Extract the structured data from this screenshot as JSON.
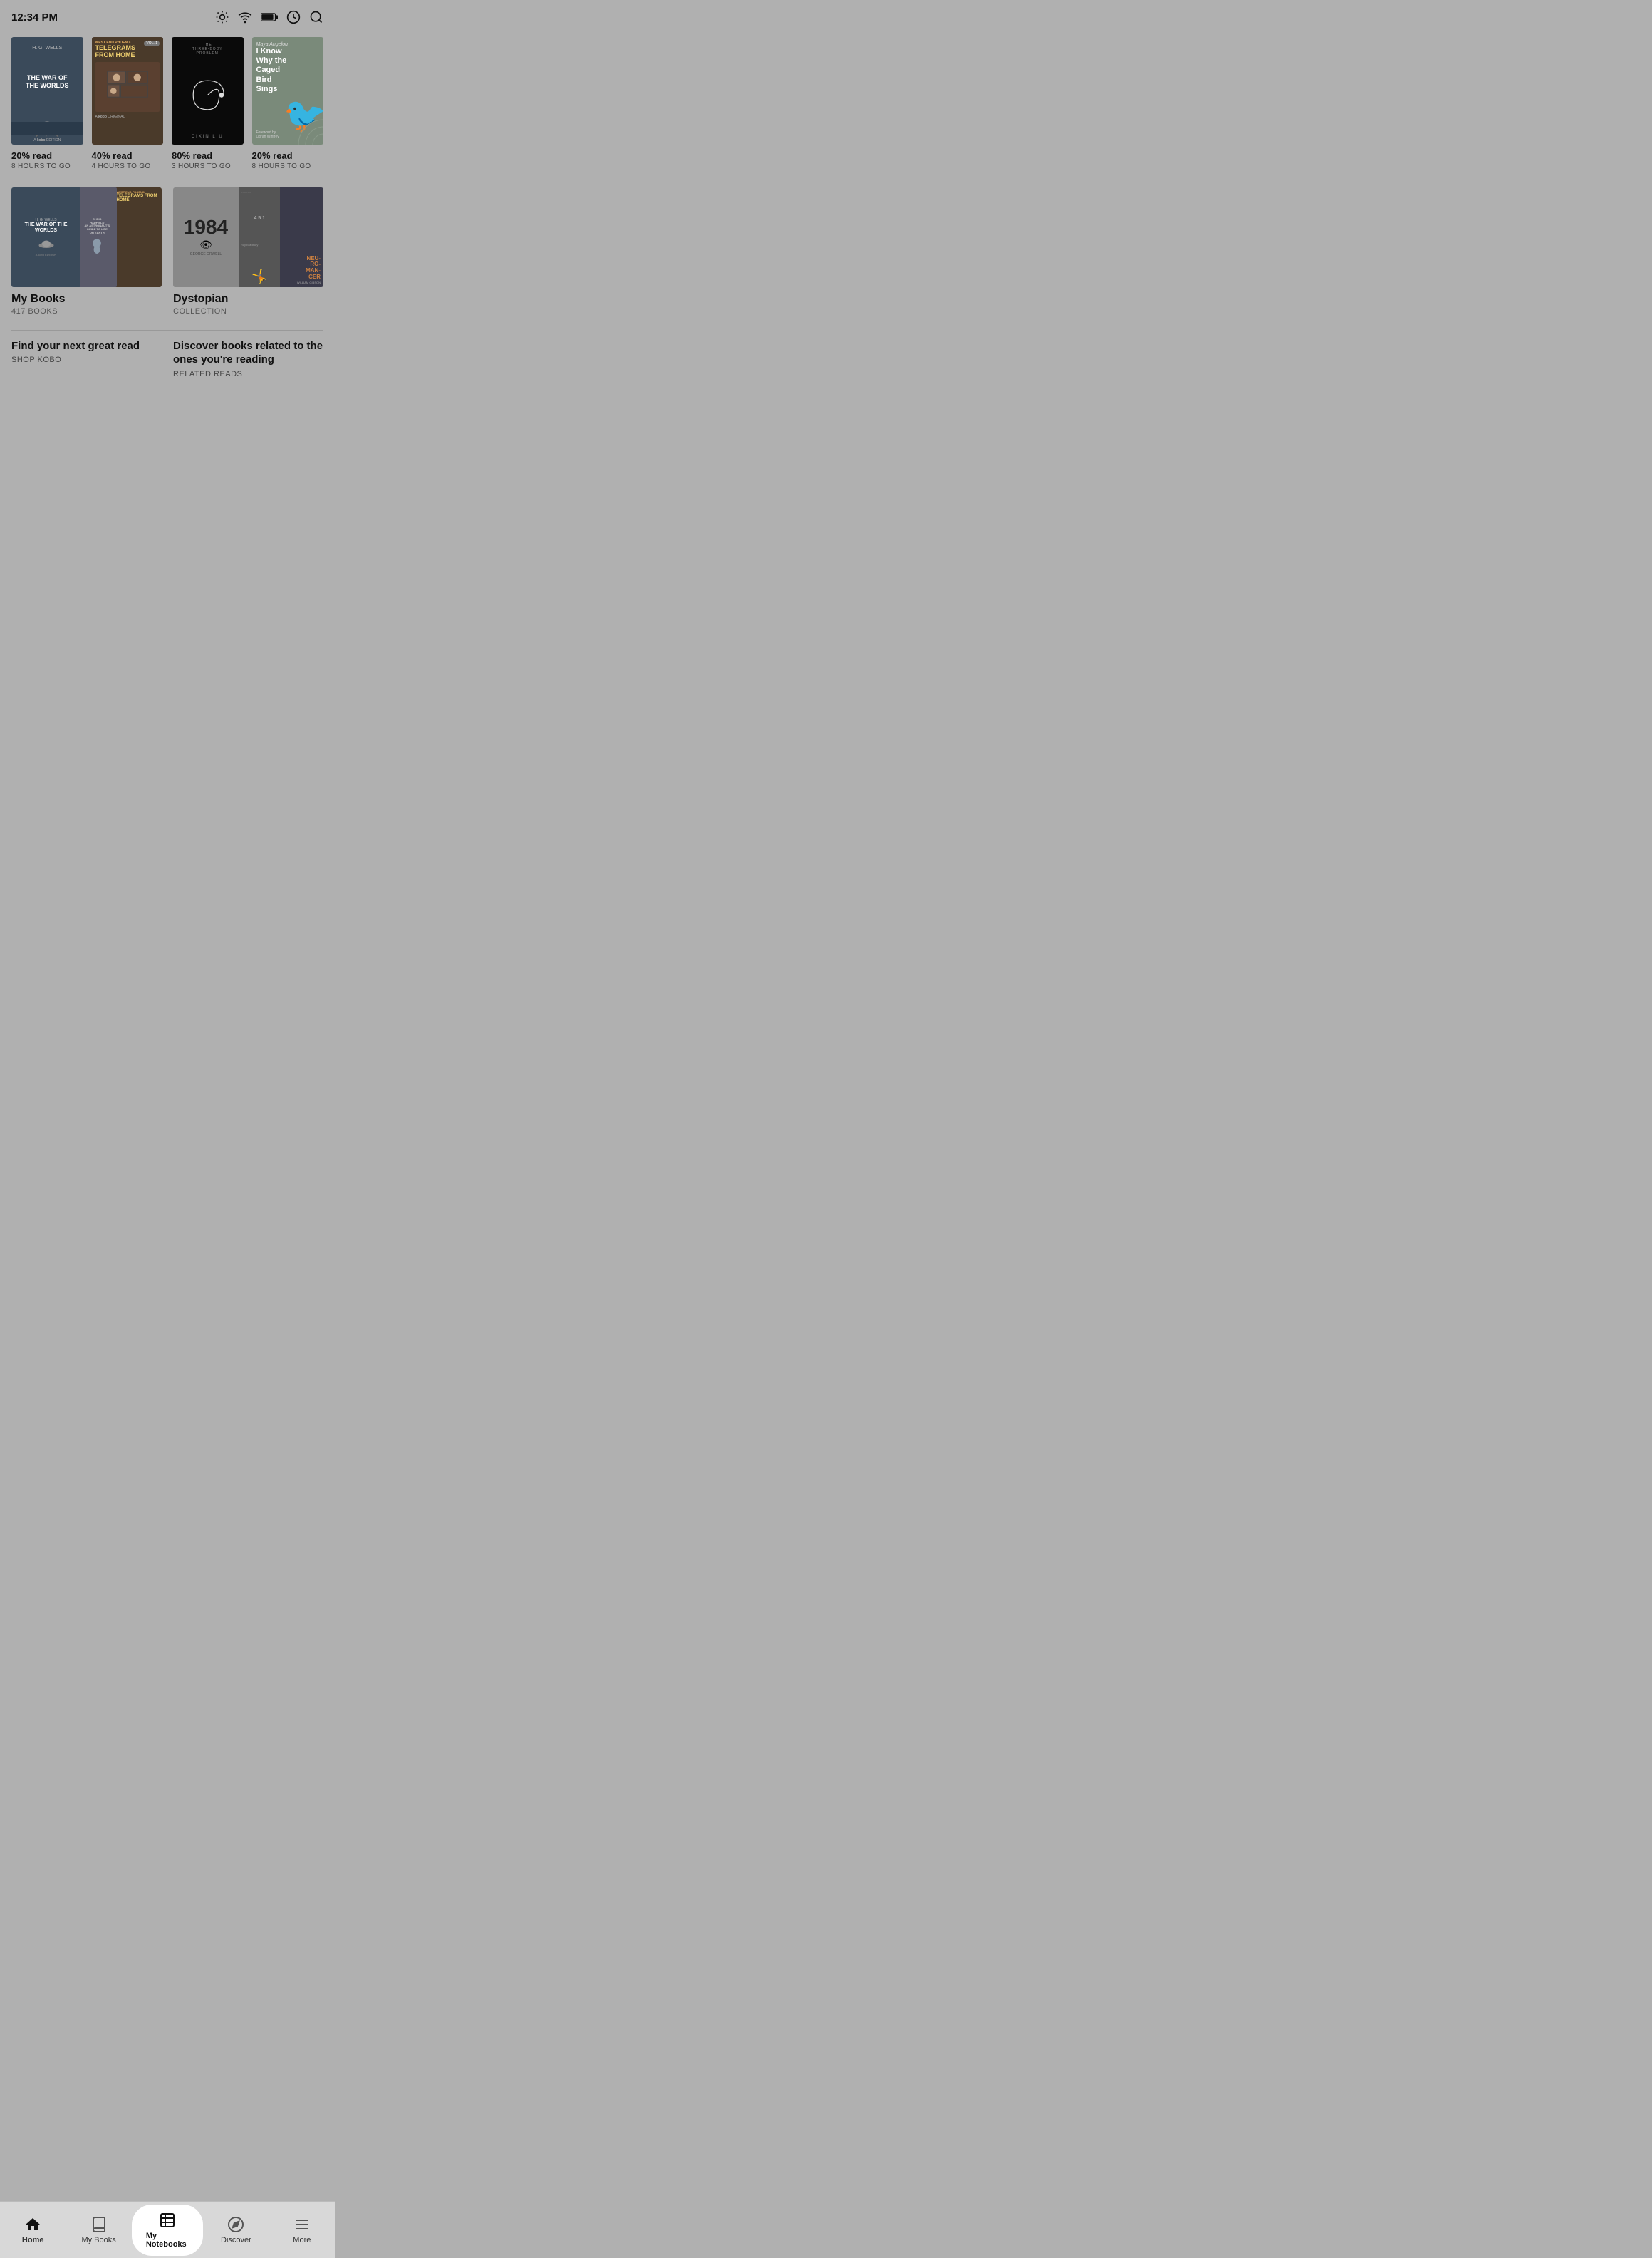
{
  "statusBar": {
    "time": "12:34 PM"
  },
  "books": [
    {
      "title": "THE WAR OF THE WORLDS",
      "author": "H. G. WELLS",
      "badge": "A kobo EDITION",
      "progress": "20% read",
      "timeLeft": "8 HOURS TO GO",
      "coverType": "war-of-worlds"
    },
    {
      "title": "TELEGRAMS FROM HOME",
      "author": "WEST END PHOENIX",
      "badge": "A kobo ORIGINAL",
      "vol": "VOL. 1",
      "progress": "40% read",
      "timeLeft": "4 HOURS TO GO",
      "coverType": "telegrams"
    },
    {
      "title": "THE THREE-BODY PROBLEM",
      "author": "CIXIN LIU",
      "progress": "80% read",
      "timeLeft": "3 HOURS TO GO",
      "coverType": "three-body"
    },
    {
      "title": "I Know Why the Caged Bird Sings",
      "author": "Maya Angelou",
      "foreword": "Foreword by Oprah Winfrey",
      "progress": "20% read",
      "timeLeft": "8 HOURS TO GO",
      "coverType": "caged-bird"
    }
  ],
  "collections": [
    {
      "name": "My Books",
      "meta": "417 BOOKS",
      "type": "my-books"
    },
    {
      "name": "Dystopian",
      "meta": "COLLECTION",
      "type": "dystopian"
    }
  ],
  "actions": [
    {
      "title": "Find your next great read",
      "subtitle": "SHOP KOBO"
    },
    {
      "title": "Discover books related to the ones you're reading",
      "subtitle": "RELATED READS"
    }
  ],
  "nav": {
    "items": [
      {
        "label": "Home",
        "icon": "home",
        "active": true
      },
      {
        "label": "My Books",
        "icon": "books"
      },
      {
        "label": "My Notebooks",
        "icon": "notebooks",
        "highlighted": true
      },
      {
        "label": "Discover",
        "icon": "discover"
      },
      {
        "label": "More",
        "icon": "more"
      }
    ]
  }
}
